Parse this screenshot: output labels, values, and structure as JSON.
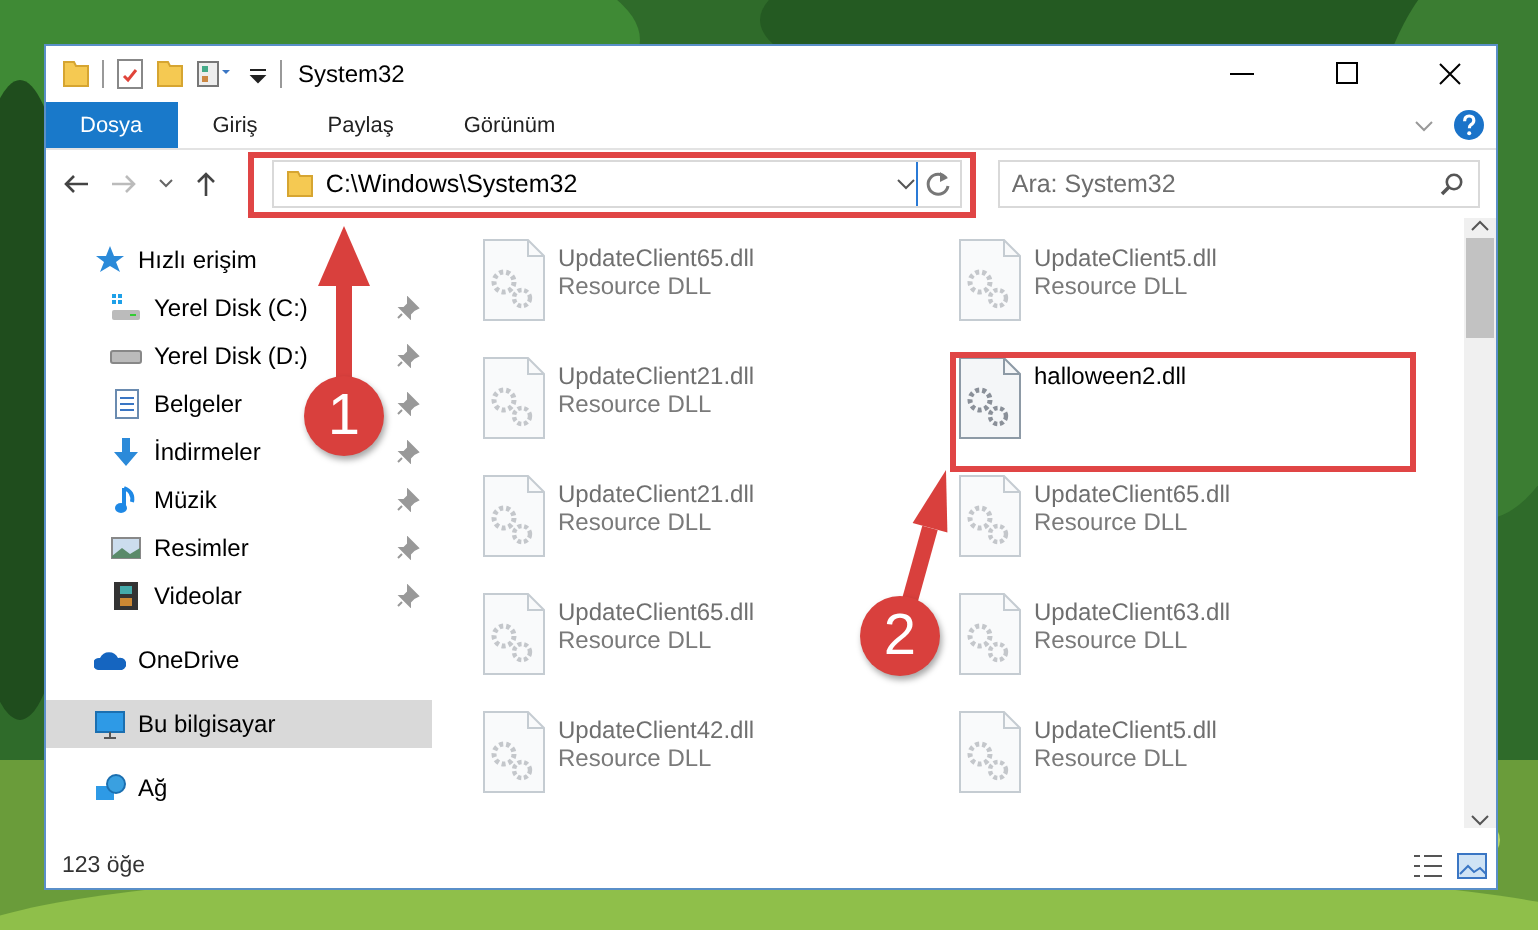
{
  "window": {
    "title": "System32"
  },
  "ribbon_tabs": [
    {
      "label": "Dosya",
      "selected": true
    },
    {
      "label": "Giriş",
      "selected": false
    },
    {
      "label": "Paylaş",
      "selected": false
    },
    {
      "label": "Görünüm",
      "selected": false
    }
  ],
  "address": {
    "path": "C:\\Windows\\System32"
  },
  "search": {
    "placeholder": "Ara: System32"
  },
  "sidebar": {
    "items": [
      {
        "label": "Hızlı erişim",
        "kind": "star",
        "selected": false,
        "children": [
          {
            "label": "Yerel Disk (C:)",
            "kind": "systemdrive",
            "pinned": true,
            "selected": false
          },
          {
            "label": "Yerel Disk (D:)",
            "kind": "drive",
            "pinned": true,
            "selected": false
          },
          {
            "label": "Belgeler",
            "kind": "document",
            "pinned": true,
            "selected": false
          },
          {
            "label": "İndirmeler",
            "kind": "download",
            "pinned": true,
            "selected": false
          },
          {
            "label": "Müzik",
            "kind": "music",
            "pinned": true,
            "selected": false
          },
          {
            "label": "Resimler",
            "kind": "pictures",
            "pinned": true,
            "selected": false
          },
          {
            "label": "Videolar",
            "kind": "video",
            "pinned": true,
            "selected": false
          }
        ]
      },
      {
        "label": "OneDrive",
        "kind": "cloud",
        "selected": false
      },
      {
        "label": "Bu bilgisayar",
        "kind": "computer",
        "selected": true
      },
      {
        "label": "Ağ",
        "kind": "network",
        "selected": false
      }
    ]
  },
  "files": [
    {
      "name": "UpdateClient65.dll",
      "type": "Resource DLL",
      "faded": true
    },
    {
      "name": "UpdateClient5.dll",
      "type": "Resource DLL",
      "faded": true
    },
    {
      "name": "UpdateClient21.dll",
      "type": "Resource DLL",
      "faded": true
    },
    {
      "name": "halloween2.dll",
      "faded": false
    },
    {
      "name": "UpdateClient21.dll",
      "type": "Resource DLL",
      "faded": true
    },
    {
      "name": "UpdateClient65.dll",
      "type": "Resource DLL",
      "faded": true
    },
    {
      "name": "UpdateClient65.dll",
      "type": "Resource DLL",
      "faded": true
    },
    {
      "name": "UpdateClient63.dll",
      "type": "Resource DLL",
      "faded": true
    },
    {
      "name": "UpdateClient42.dll",
      "type": "Resource DLL",
      "faded": true
    },
    {
      "name": "UpdateClient5.dll",
      "type": "Resource DLL",
      "faded": true
    }
  ],
  "status_bar": {
    "count": "123 öğe"
  },
  "annotations": [
    {
      "number": "1"
    },
    {
      "number": "2"
    }
  ]
}
